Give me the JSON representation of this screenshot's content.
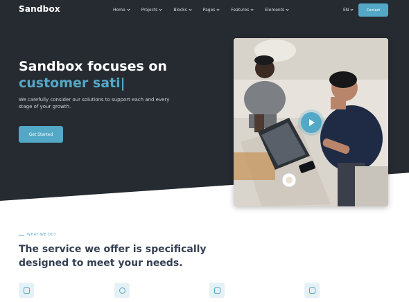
{
  "brand": {
    "logo": "Sandbox",
    "accent": "#54a8c7",
    "hero_bg": "#262b32"
  },
  "nav": {
    "items": [
      {
        "label": "Home",
        "icon": "chevron-down-icon"
      },
      {
        "label": "Projects",
        "icon": "chevron-down-icon"
      },
      {
        "label": "Blocks",
        "icon": "chevron-down-icon"
      },
      {
        "label": "Pages",
        "icon": "chevron-down-icon"
      },
      {
        "label": "Features",
        "icon": "chevron-down-icon"
      },
      {
        "label": "Elements",
        "icon": "chevron-down-icon"
      }
    ],
    "language": "EN",
    "contact_label": "Contact"
  },
  "hero": {
    "headline_line1": "Sandbox focuses on",
    "headline_line2": "customer sati|",
    "lead": "We carefully consider our solutions to support each and every stage of your growth.",
    "cta_label": "Get Started",
    "media": {
      "image": "two-people-working-at-laptop-photo",
      "play_icon": "play-icon"
    }
  },
  "services": {
    "eyebrow": "WHAT WE DO?",
    "title_line1": "The service we offer is specifically",
    "title_line2": "designed to meet your needs.",
    "feature_icons": [
      "shield-icon",
      "target-icon",
      "chart-icon",
      "devices-icon"
    ]
  }
}
